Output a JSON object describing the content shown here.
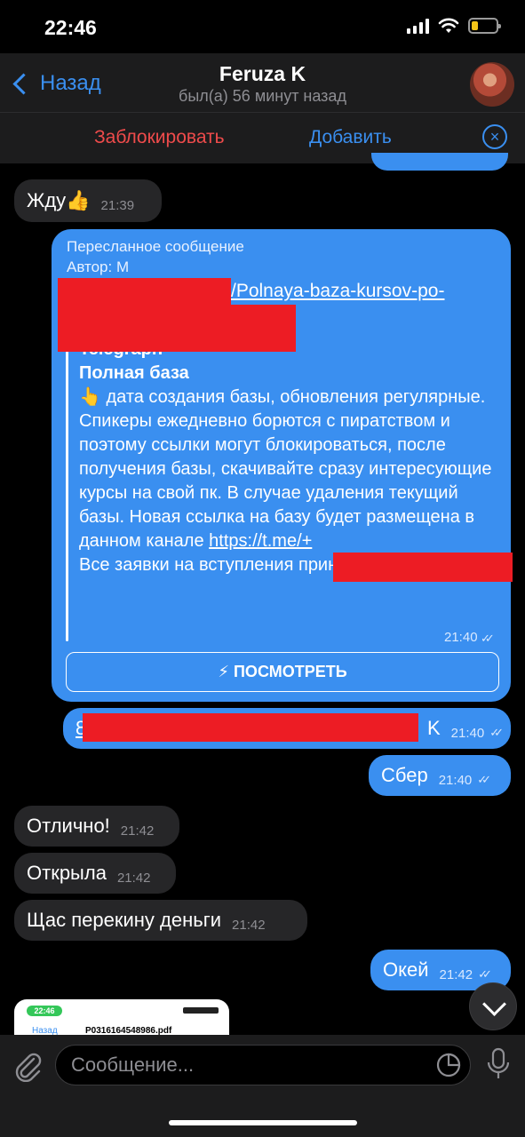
{
  "status": {
    "time": "22:46"
  },
  "header": {
    "back_label": "Назад",
    "title": "Feruza K",
    "subtitle": "был(а) 56 минут назад"
  },
  "actions": {
    "block": "Заблокировать",
    "add": "Добавить"
  },
  "messages": {
    "m1": {
      "text": "Жду👍",
      "time": "21:39"
    },
    "fwd": {
      "header": "Пересланное сообщение",
      "author": "Автор: M",
      "link_visible": "/Polnaya-baza-kursov-po-",
      "site": "Telegraph",
      "title": "Полная база",
      "body": "👆 дата создания базы, обновления регулярные. Спикеры ежедневно борются с пиратством и поэтому ссылки могут блокироваться, после получения базы, скачивайте сразу интересующие курсы на свой пк. В случае удаления текущий базы. Новая ссылка на базу будет размещена в данном канале",
      "body_link": "https://t.me/+",
      "body_tail": "Все заявки на вступления принимаются после удаления действующей базы Если пе…",
      "time": "21:40",
      "button": "⚡ ПОСМОТРЕТЬ"
    },
    "m3": {
      "prefix": "8",
      "suffix": "K",
      "time": "21:40"
    },
    "m4": {
      "text": "Сбер",
      "time": "21:40"
    },
    "m5": {
      "text": "Отлично!",
      "time": "21:42"
    },
    "m6": {
      "text": "Открыла",
      "time": "21:42"
    },
    "m7": {
      "text": "Щас перекину деньги",
      "time": "21:42"
    },
    "m8": {
      "text": "Окей",
      "time": "21:42"
    },
    "attachment": {
      "time": "22:46",
      "filename": "P0316164548986.pdf",
      "back": "Назад"
    }
  },
  "input": {
    "placeholder": "Сообщение..."
  },
  "colors": {
    "accent": "#3a8ff0",
    "block": "#ef4b4b",
    "redaction": "#ed1c24"
  }
}
